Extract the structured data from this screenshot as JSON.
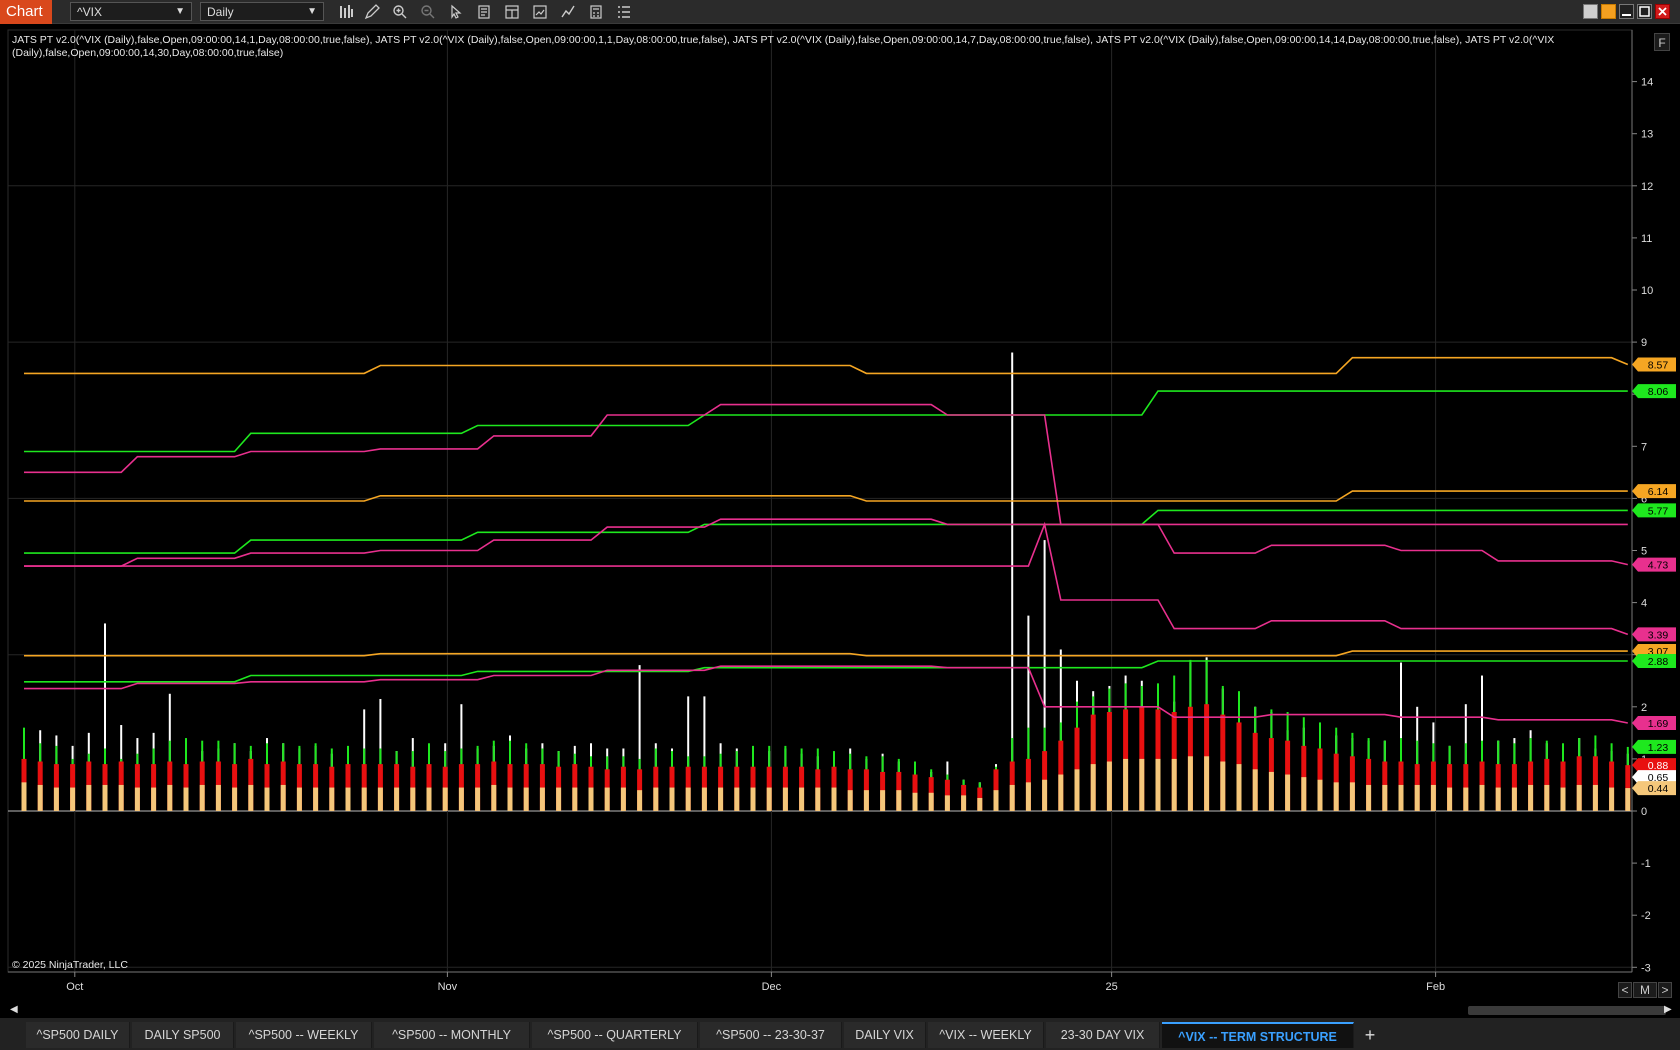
{
  "toolbar": {
    "chart_label": "Chart",
    "instrument": "^VIX",
    "interval": "Daily"
  },
  "chart": {
    "indicator_label": "JATS PT v2.0(^VIX (Daily),false,Open,09:00:00,14,1,Day,08:00:00,true,false), JATS PT v2.0(^VIX (Daily),false,Open,09:00:00,1,1,Day,08:00:00,true,false), JATS PT v2.0(^VIX (Daily),false,Open,09:00:00,14,7,Day,08:00:00,true,false), JATS PT v2.0(^VIX (Daily),false,Open,09:00:00,14,14,Day,08:00:00,true,false), JATS PT v2.0(^VIX (Daily),false,Open,09:00:00,14,30,Day,08:00:00,true,false)",
    "copyright": "© 2025 NinjaTrader, LLC",
    "f_button": "F",
    "zoom_left": "<",
    "zoom_mode": "M",
    "zoom_right": ">"
  },
  "chart_data": {
    "type": "line",
    "ylim": [
      -3.3,
      15
    ],
    "y_ticks": [
      14,
      13,
      12,
      11,
      10,
      9,
      8,
      7,
      6,
      5,
      4,
      3,
      2,
      1,
      0,
      -1,
      -2,
      -3
    ],
    "x_ticks": [
      {
        "label": "Oct",
        "index": 4
      },
      {
        "label": "Nov",
        "index": 27
      },
      {
        "label": "Dec",
        "index": 47
      },
      {
        "label": "25",
        "index": 68
      },
      {
        "label": "Feb",
        "index": 88
      }
    ],
    "bar_count": 100,
    "series": [
      {
        "color": "#f5a623",
        "value_label": "8.57",
        "steps": [
          [
            0,
            8.4
          ],
          [
            22,
            8.55
          ],
          [
            52,
            8.4
          ],
          [
            82,
            8.7
          ],
          [
            99,
            8.57
          ]
        ]
      },
      {
        "color": "#1ee81e",
        "value_label": "8.06",
        "steps": [
          [
            0,
            6.9
          ],
          [
            14,
            7.25
          ],
          [
            28,
            7.4
          ],
          [
            42,
            7.6
          ],
          [
            70,
            8.06
          ],
          [
            99,
            8.06
          ]
        ]
      },
      {
        "color": "#e8308e",
        "value_label": "",
        "steps": [
          [
            0,
            6.5
          ],
          [
            7,
            6.8
          ],
          [
            14,
            6.9
          ],
          [
            22,
            6.95
          ],
          [
            29,
            7.2
          ],
          [
            36,
            7.6
          ],
          [
            43,
            7.8
          ],
          [
            57,
            7.6
          ],
          [
            63,
            7.6
          ],
          [
            64,
            5.5
          ],
          [
            70,
            5.5
          ],
          [
            99,
            5.5
          ]
        ]
      },
      {
        "color": "#f5a623",
        "value_label": "6.14",
        "steps": [
          [
            0,
            5.95
          ],
          [
            22,
            6.05
          ],
          [
            52,
            5.95
          ],
          [
            82,
            6.14
          ],
          [
            99,
            6.14
          ]
        ]
      },
      {
        "color": "#1ee81e",
        "value_label": "5.77",
        "steps": [
          [
            0,
            4.95
          ],
          [
            14,
            5.2
          ],
          [
            28,
            5.35
          ],
          [
            42,
            5.5
          ],
          [
            70,
            5.77
          ],
          [
            99,
            5.77
          ]
        ]
      },
      {
        "color": "#e8308e",
        "value_label": "4.73",
        "steps": [
          [
            0,
            4.7
          ],
          [
            7,
            4.85
          ],
          [
            14,
            4.95
          ],
          [
            22,
            5.0
          ],
          [
            29,
            5.2
          ],
          [
            36,
            5.45
          ],
          [
            43,
            5.6
          ],
          [
            57,
            5.5
          ],
          [
            63,
            5.5
          ],
          [
            71,
            4.95
          ],
          [
            77,
            5.1
          ],
          [
            85,
            5.0
          ],
          [
            91,
            4.8
          ],
          [
            99,
            4.73
          ]
        ]
      },
      {
        "color": "#e8308e",
        "value_label": "3.39",
        "steps": [
          [
            0,
            4.7
          ],
          [
            63,
            5.5
          ],
          [
            64,
            4.05
          ],
          [
            70,
            4.05
          ],
          [
            71,
            3.5
          ],
          [
            77,
            3.65
          ],
          [
            85,
            3.5
          ],
          [
            99,
            3.39
          ]
        ]
      },
      {
        "color": "#f5a623",
        "value_label": "3.07",
        "steps": [
          [
            0,
            2.98
          ],
          [
            22,
            3.02
          ],
          [
            52,
            2.98
          ],
          [
            82,
            3.07
          ],
          [
            99,
            3.07
          ]
        ]
      },
      {
        "color": "#1ee81e",
        "value_label": "2.88",
        "steps": [
          [
            0,
            2.48
          ],
          [
            14,
            2.6
          ],
          [
            28,
            2.68
          ],
          [
            42,
            2.75
          ],
          [
            70,
            2.88
          ],
          [
            99,
            2.88
          ]
        ]
      },
      {
        "color": "#e8308e",
        "value_label": "1.69",
        "steps": [
          [
            0,
            2.35
          ],
          [
            7,
            2.45
          ],
          [
            14,
            2.48
          ],
          [
            22,
            2.52
          ],
          [
            29,
            2.6
          ],
          [
            36,
            2.7
          ],
          [
            43,
            2.78
          ],
          [
            57,
            2.75
          ],
          [
            63,
            2.0
          ],
          [
            70,
            2.0
          ],
          [
            71,
            1.8
          ],
          [
            77,
            1.85
          ],
          [
            85,
            1.8
          ],
          [
            91,
            1.75
          ],
          [
            99,
            1.69
          ]
        ]
      }
    ],
    "histogram": {
      "white": [
        1.4,
        1.55,
        1.45,
        1.25,
        1.5,
        3.6,
        1.65,
        1.4,
        1.5,
        2.25,
        1.3,
        1.15,
        1.2,
        1.3,
        1.15,
        1.4,
        1.3,
        1.2,
        1.25,
        1.1,
        1.2,
        1.95,
        2.15,
        1.15,
        1.4,
        1.2,
        1.3,
        2.05,
        1.2,
        1.25,
        1.45,
        1.2,
        1.3,
        1.15,
        1.25,
        1.3,
        1.2,
        1.2,
        2.8,
        1.3,
        1.2,
        2.2,
        2.2,
        1.3,
        1.2,
        1.15,
        1.15,
        1.2,
        1.1,
        1.05,
        1.0,
        1.2,
        1.0,
        1.1,
        0.95,
        0.85,
        0.75,
        0.95,
        0.6,
        0.55,
        0.9,
        8.8,
        3.75,
        5.2,
        3.1,
        2.5,
        2.3,
        2.4,
        2.6,
        2.5,
        2.35,
        2.1,
        2.85,
        2.95,
        2.35,
        2.2,
        2.0,
        1.9,
        1.55,
        1.6,
        1.45,
        1.45,
        1.4,
        1.35,
        1.35,
        2.85,
        2.0,
        1.7,
        1.25,
        2.05,
        2.6,
        1.35,
        1.4,
        1.55,
        1.3,
        1.25,
        1.4,
        1.2,
        1.15,
        1.1
      ],
      "green": [
        1.6,
        1.3,
        1.25,
        1.0,
        1.1,
        1.2,
        1.0,
        1.1,
        1.2,
        1.35,
        1.4,
        1.35,
        1.35,
        1.3,
        1.25,
        1.3,
        1.3,
        1.25,
        1.3,
        1.2,
        1.25,
        1.2,
        1.2,
        1.15,
        1.15,
        1.3,
        1.15,
        1.2,
        1.25,
        1.35,
        1.35,
        1.3,
        1.2,
        1.15,
        1.1,
        1.05,
        1.05,
        1.05,
        1.0,
        1.2,
        1.15,
        1.05,
        1.05,
        1.1,
        1.15,
        1.25,
        1.25,
        1.25,
        1.2,
        1.2,
        1.15,
        1.1,
        1.05,
        1.05,
        1.0,
        0.95,
        0.8,
        0.7,
        0.6,
        0.55,
        0.85,
        1.4,
        1.6,
        1.6,
        1.7,
        2.1,
        2.2,
        2.35,
        2.45,
        2.4,
        2.45,
        2.6,
        2.9,
        2.9,
        2.4,
        2.3,
        2.0,
        1.95,
        1.9,
        1.8,
        1.7,
        1.6,
        1.5,
        1.4,
        1.35,
        1.4,
        1.35,
        1.3,
        1.25,
        1.3,
        1.35,
        1.35,
        1.3,
        1.4,
        1.35,
        1.3,
        1.4,
        1.45,
        1.3,
        1.23
      ],
      "red": [
        1.0,
        0.95,
        0.9,
        0.9,
        0.95,
        0.9,
        0.95,
        0.9,
        0.9,
        0.95,
        0.9,
        0.95,
        0.95,
        0.9,
        1.0,
        0.9,
        0.95,
        0.9,
        0.9,
        0.85,
        0.9,
        0.9,
        0.9,
        0.9,
        0.85,
        0.9,
        0.85,
        0.9,
        0.9,
        0.95,
        0.9,
        0.9,
        0.9,
        0.85,
        0.9,
        0.85,
        0.8,
        0.85,
        0.8,
        0.85,
        0.85,
        0.85,
        0.85,
        0.85,
        0.85,
        0.85,
        0.85,
        0.85,
        0.85,
        0.8,
        0.85,
        0.8,
        0.8,
        0.75,
        0.75,
        0.7,
        0.65,
        0.6,
        0.5,
        0.45,
        0.8,
        0.95,
        1.0,
        1.15,
        1.35,
        1.6,
        1.85,
        1.9,
        1.95,
        2.0,
        1.95,
        1.9,
        2.0,
        2.05,
        1.85,
        1.7,
        1.5,
        1.4,
        1.35,
        1.25,
        1.2,
        1.1,
        1.05,
        1.0,
        0.95,
        0.95,
        0.9,
        0.95,
        0.9,
        0.9,
        0.95,
        0.9,
        0.9,
        0.95,
        1.0,
        0.95,
        1.05,
        1.05,
        0.95,
        0.88
      ],
      "yellow": [
        0.55,
        0.5,
        0.45,
        0.45,
        0.5,
        0.5,
        0.5,
        0.45,
        0.45,
        0.5,
        0.45,
        0.5,
        0.5,
        0.45,
        0.5,
        0.45,
        0.5,
        0.45,
        0.45,
        0.45,
        0.45,
        0.45,
        0.45,
        0.45,
        0.45,
        0.45,
        0.45,
        0.45,
        0.45,
        0.5,
        0.45,
        0.45,
        0.45,
        0.45,
        0.45,
        0.45,
        0.45,
        0.45,
        0.4,
        0.45,
        0.45,
        0.45,
        0.45,
        0.45,
        0.45,
        0.45,
        0.45,
        0.45,
        0.45,
        0.45,
        0.45,
        0.4,
        0.4,
        0.4,
        0.4,
        0.35,
        0.35,
        0.3,
        0.3,
        0.25,
        0.4,
        0.5,
        0.55,
        0.6,
        0.7,
        0.8,
        0.9,
        0.95,
        1.0,
        1.0,
        1.0,
        1.0,
        1.05,
        1.05,
        0.95,
        0.9,
        0.8,
        0.75,
        0.7,
        0.65,
        0.6,
        0.55,
        0.55,
        0.5,
        0.5,
        0.5,
        0.5,
        0.5,
        0.45,
        0.45,
        0.5,
        0.45,
        0.45,
        0.5,
        0.5,
        0.45,
        0.5,
        0.5,
        0.45,
        0.44
      ]
    },
    "extra_labels": [
      {
        "value": 1.23,
        "text": "1.23",
        "bg": "#1ee81e",
        "fg": "#000"
      },
      {
        "value": 0.88,
        "text": "0.88",
        "bg": "#e81010",
        "fg": "#fff"
      },
      {
        "value": 0.65,
        "text": "0.65",
        "bg": "#ffffff",
        "fg": "#000"
      },
      {
        "value": 0.44,
        "text": "0.44",
        "bg": "#f5c77a",
        "fg": "#000"
      }
    ]
  },
  "tabs": [
    {
      "label": "^SP500 DAILY",
      "active": false
    },
    {
      "label": "DAILY SP500",
      "active": false
    },
    {
      "label": "^SP500 -- WEEKLY",
      "active": false
    },
    {
      "label": "^SP500 -- MONTHLY",
      "active": false
    },
    {
      "label": "^SP500 -- QUARTERLY",
      "active": false
    },
    {
      "label": "^SP500 -- 23-30-37",
      "active": false
    },
    {
      "label": "DAILY VIX",
      "active": false
    },
    {
      "label": "^VIX -- WEEKLY",
      "active": false
    },
    {
      "label": "23-30 DAY VIX",
      "active": false
    },
    {
      "label": "^VIX -- TERM STRUCTURE",
      "active": true
    }
  ],
  "tab_add": "+"
}
